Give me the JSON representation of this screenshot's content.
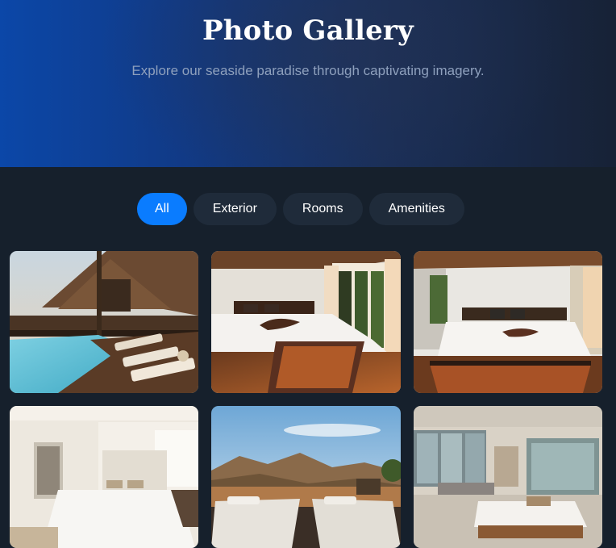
{
  "hero": {
    "title": "Photo Gallery",
    "subtitle": "Explore our seaside paradise through captivating imagery."
  },
  "filters": [
    {
      "label": "All",
      "active": true
    },
    {
      "label": "Exterior",
      "active": false
    },
    {
      "label": "Rooms",
      "active": false
    },
    {
      "label": "Amenities",
      "active": false
    }
  ],
  "gallery": [
    {
      "subject": "resort lodge with pool and sun loungers"
    },
    {
      "subject": "bedroom with wooden ceiling and balcony doors"
    },
    {
      "subject": "bedroom with wooden platform bed"
    },
    {
      "subject": "bright white bedroom"
    },
    {
      "subject": "terrace loungers with mountain view"
    },
    {
      "subject": "modern open-plan bedroom with glass enclosure"
    }
  ],
  "colors": {
    "accent": "#0a7cff",
    "chip": "#1f2b3a",
    "background": "#16202c"
  }
}
